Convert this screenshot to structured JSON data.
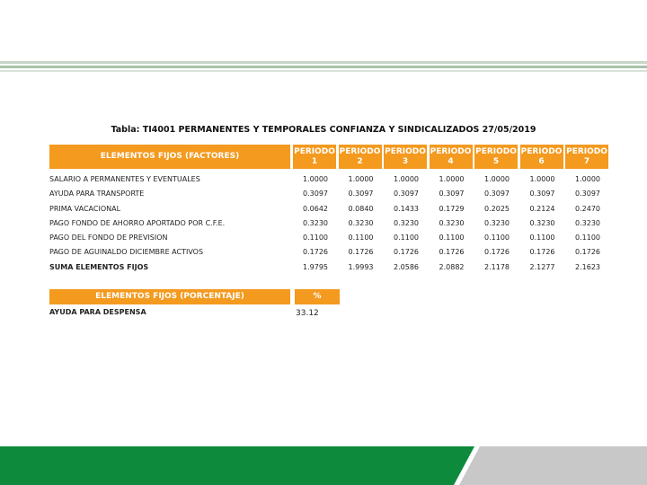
{
  "title": "Tabla: TI4001 PERMANENTES Y TEMPORALES CONFIANZA Y SINDICALIZADOS 27/05/2019",
  "factors_header": "ELEMENTOS FIJOS (FACTORES)",
  "periods": [
    {
      "label": "PERIODO",
      "num": "1"
    },
    {
      "label": "PERIODO",
      "num": "2"
    },
    {
      "label": "PERIODO",
      "num": "3"
    },
    {
      "label": "PERIODO",
      "num": "4"
    },
    {
      "label": "PERIODO",
      "num": "5"
    },
    {
      "label": "PERIODO",
      "num": "6"
    },
    {
      "label": "PERIODO",
      "num": "7"
    }
  ],
  "rows": [
    {
      "label": "SALARIO A PERMANENTES Y EVENTUALES",
      "values": [
        "1.0000",
        "1.0000",
        "1.0000",
        "1.0000",
        "1.0000",
        "1.0000",
        "1.0000"
      ]
    },
    {
      "label": "AYUDA PARA TRANSPORTE",
      "values": [
        "0.3097",
        "0.3097",
        "0.3097",
        "0.3097",
        "0.3097",
        "0.3097",
        "0.3097"
      ]
    },
    {
      "label": "PRIMA VACACIONAL",
      "values": [
        "0.0642",
        "0.0840",
        "0.1433",
        "0.1729",
        "0.2025",
        "0.2124",
        "0.2470"
      ]
    },
    {
      "label": "PAGO FONDO DE AHORRO APORTADO POR C.F.E.",
      "values": [
        "0.3230",
        "0.3230",
        "0.3230",
        "0.3230",
        "0.3230",
        "0.3230",
        "0.3230"
      ]
    },
    {
      "label": "PAGO DEL FONDO DE PREVISION",
      "values": [
        "0.1100",
        "0.1100",
        "0.1100",
        "0.1100",
        "0.1100",
        "0.1100",
        "0.1100"
      ]
    },
    {
      "label": "PAGO DE AGUINALDO DICIEMBRE ACTIVOS",
      "values": [
        "0.1726",
        "0.1726",
        "0.1726",
        "0.1726",
        "0.1726",
        "0.1726",
        "0.1726"
      ]
    },
    {
      "label": "SUMA ELEMENTOS FIJOS",
      "values": [
        "1.9795",
        "1.9993",
        "2.0586",
        "2.0882",
        "2.1178",
        "2.1277",
        "2.1623"
      ],
      "sum": true
    }
  ],
  "percent_header": "ELEMENTOS FIJOS (PORCENTAJE)",
  "percent_symbol": "%",
  "percent_row": {
    "label": "AYUDA PARA DESPENSA",
    "value": "33.12"
  },
  "colors": {
    "header_orange": "#f39a1f",
    "footer_green": "#0e8a3c",
    "footer_grey": "#c8c8c8"
  }
}
